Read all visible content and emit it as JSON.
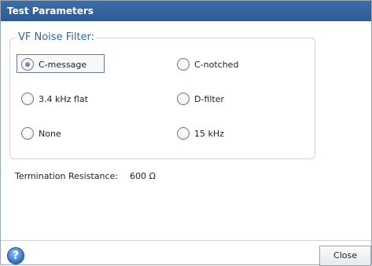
{
  "window": {
    "title": "Test Parameters"
  },
  "filter_group": {
    "legend": "VF Noise Filter:",
    "options": [
      {
        "label": "C-message",
        "selected": true
      },
      {
        "label": "C-notched",
        "selected": false
      },
      {
        "label": "3.4 kHz flat",
        "selected": false
      },
      {
        "label": "D-filter",
        "selected": false
      },
      {
        "label": "None",
        "selected": false
      },
      {
        "label": "15 kHz",
        "selected": false
      }
    ]
  },
  "termination": {
    "label": "Termination Resistance:",
    "value": "600 Ω"
  },
  "footer": {
    "help_icon": "help-icon",
    "help_glyph": "?",
    "close_label": "Close"
  },
  "colors": {
    "titlebar": "#2f5f9a",
    "legend": "#2f65b1"
  }
}
